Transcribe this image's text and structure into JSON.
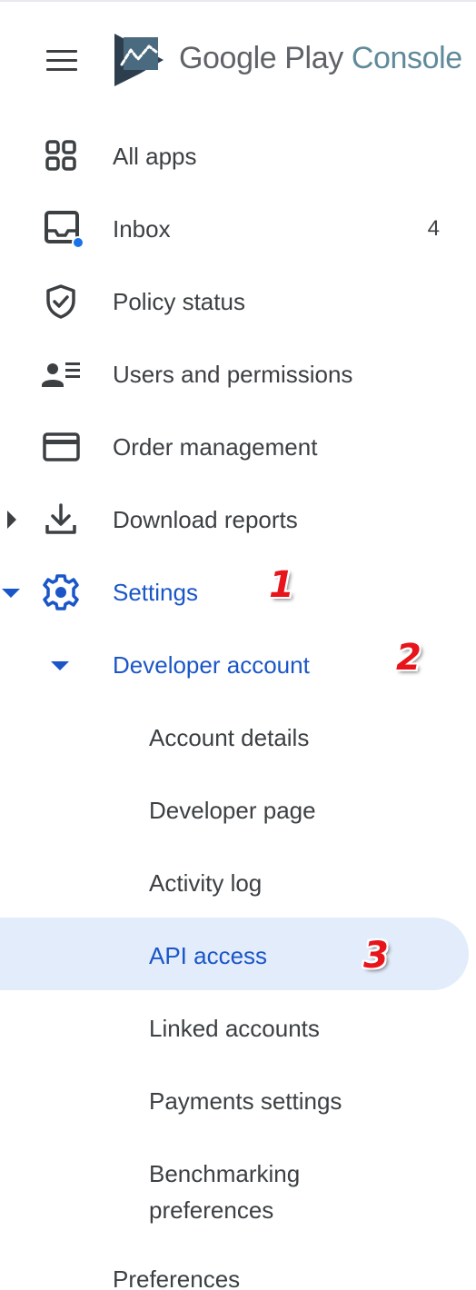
{
  "header": {
    "brand_main": "Google Play",
    "brand_sub": "Console"
  },
  "nav": {
    "all_apps": "All apps",
    "inbox": "Inbox",
    "inbox_count": "4",
    "policy_status": "Policy status",
    "users_permissions": "Users and permissions",
    "order_management": "Order management",
    "download_reports": "Download reports",
    "settings": "Settings",
    "developer_account": "Developer account",
    "account_details": "Account details",
    "developer_page": "Developer page",
    "activity_log": "Activity log",
    "api_access": "API access",
    "linked_accounts": "Linked accounts",
    "payments_settings": "Payments settings",
    "benchmarking_preferences": "Benchmarking preferences",
    "preferences": "Preferences"
  },
  "annotations": {
    "one": "1",
    "two": "2",
    "three": "3"
  },
  "colors": {
    "active": "#1a56c8",
    "highlight": "#e3ecfb",
    "text": "#3c4043",
    "annotation": "#e8141b",
    "inbox_dot": "#1a73e8"
  },
  "icons": {
    "menu": "hamburger-menu-icon",
    "logo": "play-console-logo",
    "all_apps": "grid-icon",
    "inbox": "inbox-icon",
    "policy_status": "shield-check-icon",
    "users_permissions": "users-list-icon",
    "order_management": "credit-card-icon",
    "download_reports": "download-icon",
    "settings": "gear-icon"
  }
}
